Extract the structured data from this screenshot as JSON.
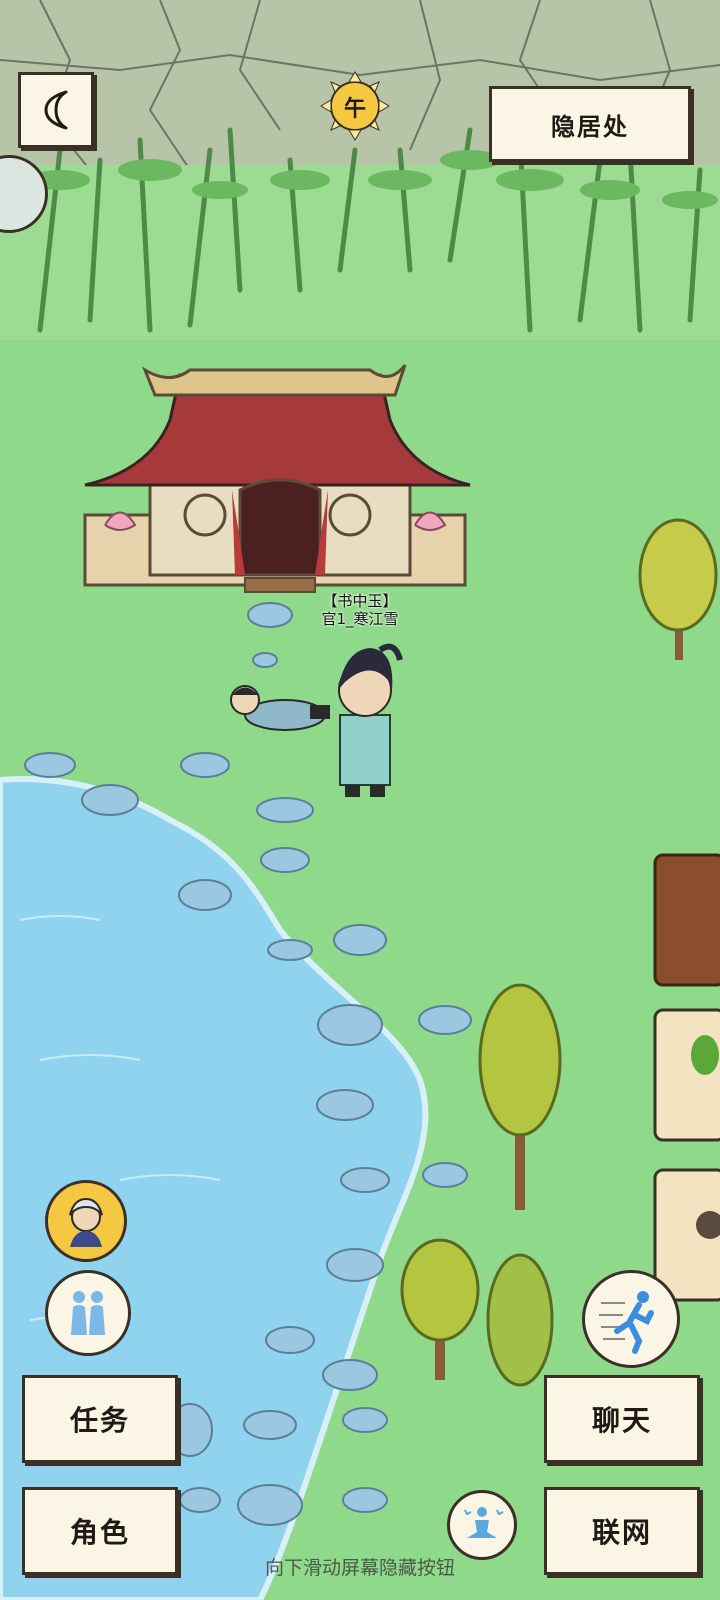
{
  "location": {
    "name": "隐居处"
  },
  "time": {
    "symbol": "午"
  },
  "character": {
    "title": "【书中玉】",
    "name": "官1_寒江雪"
  },
  "buttons": {
    "task": "任务",
    "role": "角色",
    "chat": "聊天",
    "network": "联网"
  },
  "hint": "向下滑动屏幕隐藏按钮",
  "colors": {
    "grass": "#8fd98a",
    "water": "#8fd3ef",
    "cliff": "#b8c4a8",
    "roof": "#a63a3a",
    "panel": "#fbf5e6",
    "ink": "#3a3026"
  },
  "icons": [
    "back-arrow-icon",
    "sun-icon",
    "companion-avatar-icon",
    "couple-icon",
    "run-icon",
    "meditate-icon"
  ]
}
